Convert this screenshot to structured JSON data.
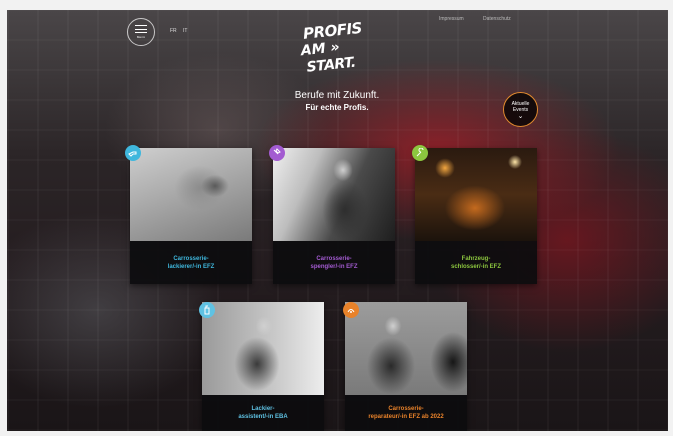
{
  "header": {
    "menu_label": "Menü",
    "lang_1": "FR",
    "lang_2": "IT",
    "links": [
      "Impressum",
      "Datenschutz"
    ]
  },
  "logo": {
    "line1": "PROFIS",
    "line2": "AM »",
    "line3": "START."
  },
  "tagline": {
    "line1": "Berufe mit Zukunft.",
    "line2": "Für echte Profis."
  },
  "events": {
    "line1": "Aktuelle",
    "line2": "Events"
  },
  "cards": [
    {
      "title": "Carrosserie-\nlackierer/-in EFZ",
      "color": "#3fb7dd",
      "icon": "spray-gun-icon"
    },
    {
      "title": "Carrosserie-\nspengler/-in EFZ",
      "color": "#a35bd1",
      "icon": "hammer-icon"
    },
    {
      "title": "Fahrzeug-\nschlosser/-in EFZ",
      "color": "#8cc63f",
      "icon": "wrench-icon"
    },
    {
      "title": "Lackier-\nassistent/-in EBA",
      "color": "#5fc2e3",
      "icon": "spray-can-icon"
    },
    {
      "title": "Carrosserie-\nreparateur/-in EFZ ab 2022",
      "color": "#e8822a",
      "icon": "repair-icon"
    }
  ]
}
